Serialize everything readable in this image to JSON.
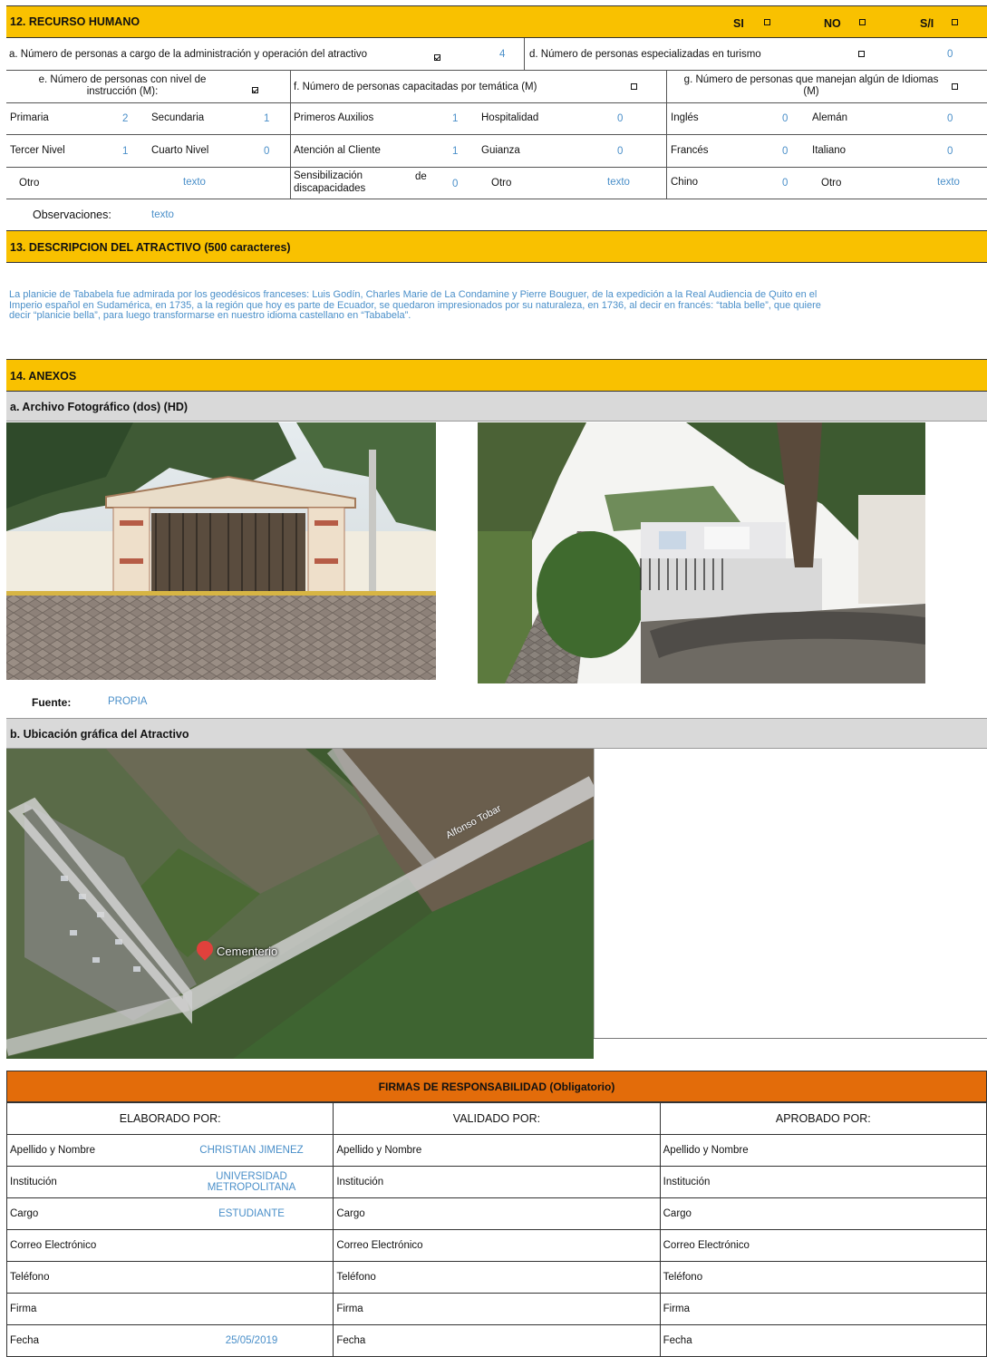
{
  "section12": {
    "title": "12. RECURSO HUMANO",
    "si": "SI",
    "no": "NO",
    "si_na": "S/I",
    "a_label": "a. Número de personas a cargo de la administración y operación del atractivo",
    "a_value": "4",
    "d_label": "d. Número de personas especializadas en turismo",
    "d_value": "0",
    "e_label": "e. Número de personas con nivel de instrucción (M):",
    "f_label": "f. Número de personas capacitadas por temática (M)",
    "g_label": "g. Número de personas que manejan algún de Idiomas (M)",
    "rows": {
      "primaria": "Primaria",
      "primaria_v": "2",
      "secundaria": "Secundaria",
      "secundaria_v": "1",
      "tercer": "Tercer Nivel",
      "tercer_v": "1",
      "cuarto": "Cuarto Nivel",
      "cuarto_v": "0",
      "otro_e": "Otro",
      "otro_e_v": "texto",
      "auxilios": "Primeros Auxilios",
      "auxilios_v": "1",
      "hospitalidad": "Hospitalidad",
      "hospitalidad_v": "0",
      "atencion": "Atención al Cliente",
      "atencion_v": "1",
      "guianza": "Guianza",
      "guianza_v": "0",
      "sensib_1": "Sensibilización",
      "sensib_de": "de",
      "sensib_2": "discapacidades",
      "sensib_v": "0",
      "otro_f": "Otro",
      "otro_f_v": "texto",
      "ingles": "Inglés",
      "ingles_v": "0",
      "aleman": "Alemán",
      "aleman_v": "0",
      "frances": "Francés",
      "frances_v": "0",
      "italiano": "Italiano",
      "italiano_v": "0",
      "chino": "Chino",
      "chino_v": "0",
      "otro_g": "Otro",
      "otro_g_v": "texto"
    },
    "obs_label": "Observaciones:",
    "obs_value": "texto"
  },
  "section13": {
    "title": "13. DESCRIPCION DEL ATRACTIVO (500 caracteres)",
    "line1": "La planicie de Tababela fue admirada por los geodésicos franceses: Luis Godín, Charles Marie de La Condamine y Pierre Bouguer, de la expedición a la Real Audiencia de Quito en el",
    "line2": "Imperio español en Sudamérica, en 1735, a la región que hoy es parte de Ecuador, se quedaron impresionados por su naturaleza, en 1736, al decir en francés: “tabla belle”, que quiere",
    "line3": "decir “planicie bella”, para luego transformarse en nuestro idioma castellano en “Tababela”."
  },
  "section14": {
    "title": "14. ANEXOS",
    "photos_title": "a. Archivo Fotográfico (dos) (HD)",
    "fuente_label": "Fuente:",
    "fuente_value": "PROPIA",
    "map_title": "b. Ubicación gráfica del Atractivo",
    "map_street": "Alfonso Tobar",
    "map_pin": "Cementerio"
  },
  "firmas": {
    "title": "FIRMAS DE RESPONSABILIDAD (Obligatorio)",
    "col1": "ELABORADO POR:",
    "col2": "VALIDADO  POR:",
    "col3": "APROBADO POR:",
    "apellido": "Apellido y Nombre",
    "institucion": "Institución",
    "cargo": "Cargo",
    "correo": "Correo Electrónico",
    "telefono": "Teléfono",
    "firma": "Firma",
    "fecha": "Fecha",
    "elab_nombre": "CHRISTIAN JIMENEZ",
    "elab_inst_1": "UNIVERSIDAD",
    "elab_inst_2": "METROPOLITANA",
    "elab_cargo": "ESTUDIANTE",
    "elab_fecha": "25/05/2019"
  },
  "colors": {
    "band": "#f9c100",
    "firmas_band": "#e36c0a",
    "value": "#4a8fc9",
    "gray": "#d9d9d9"
  }
}
